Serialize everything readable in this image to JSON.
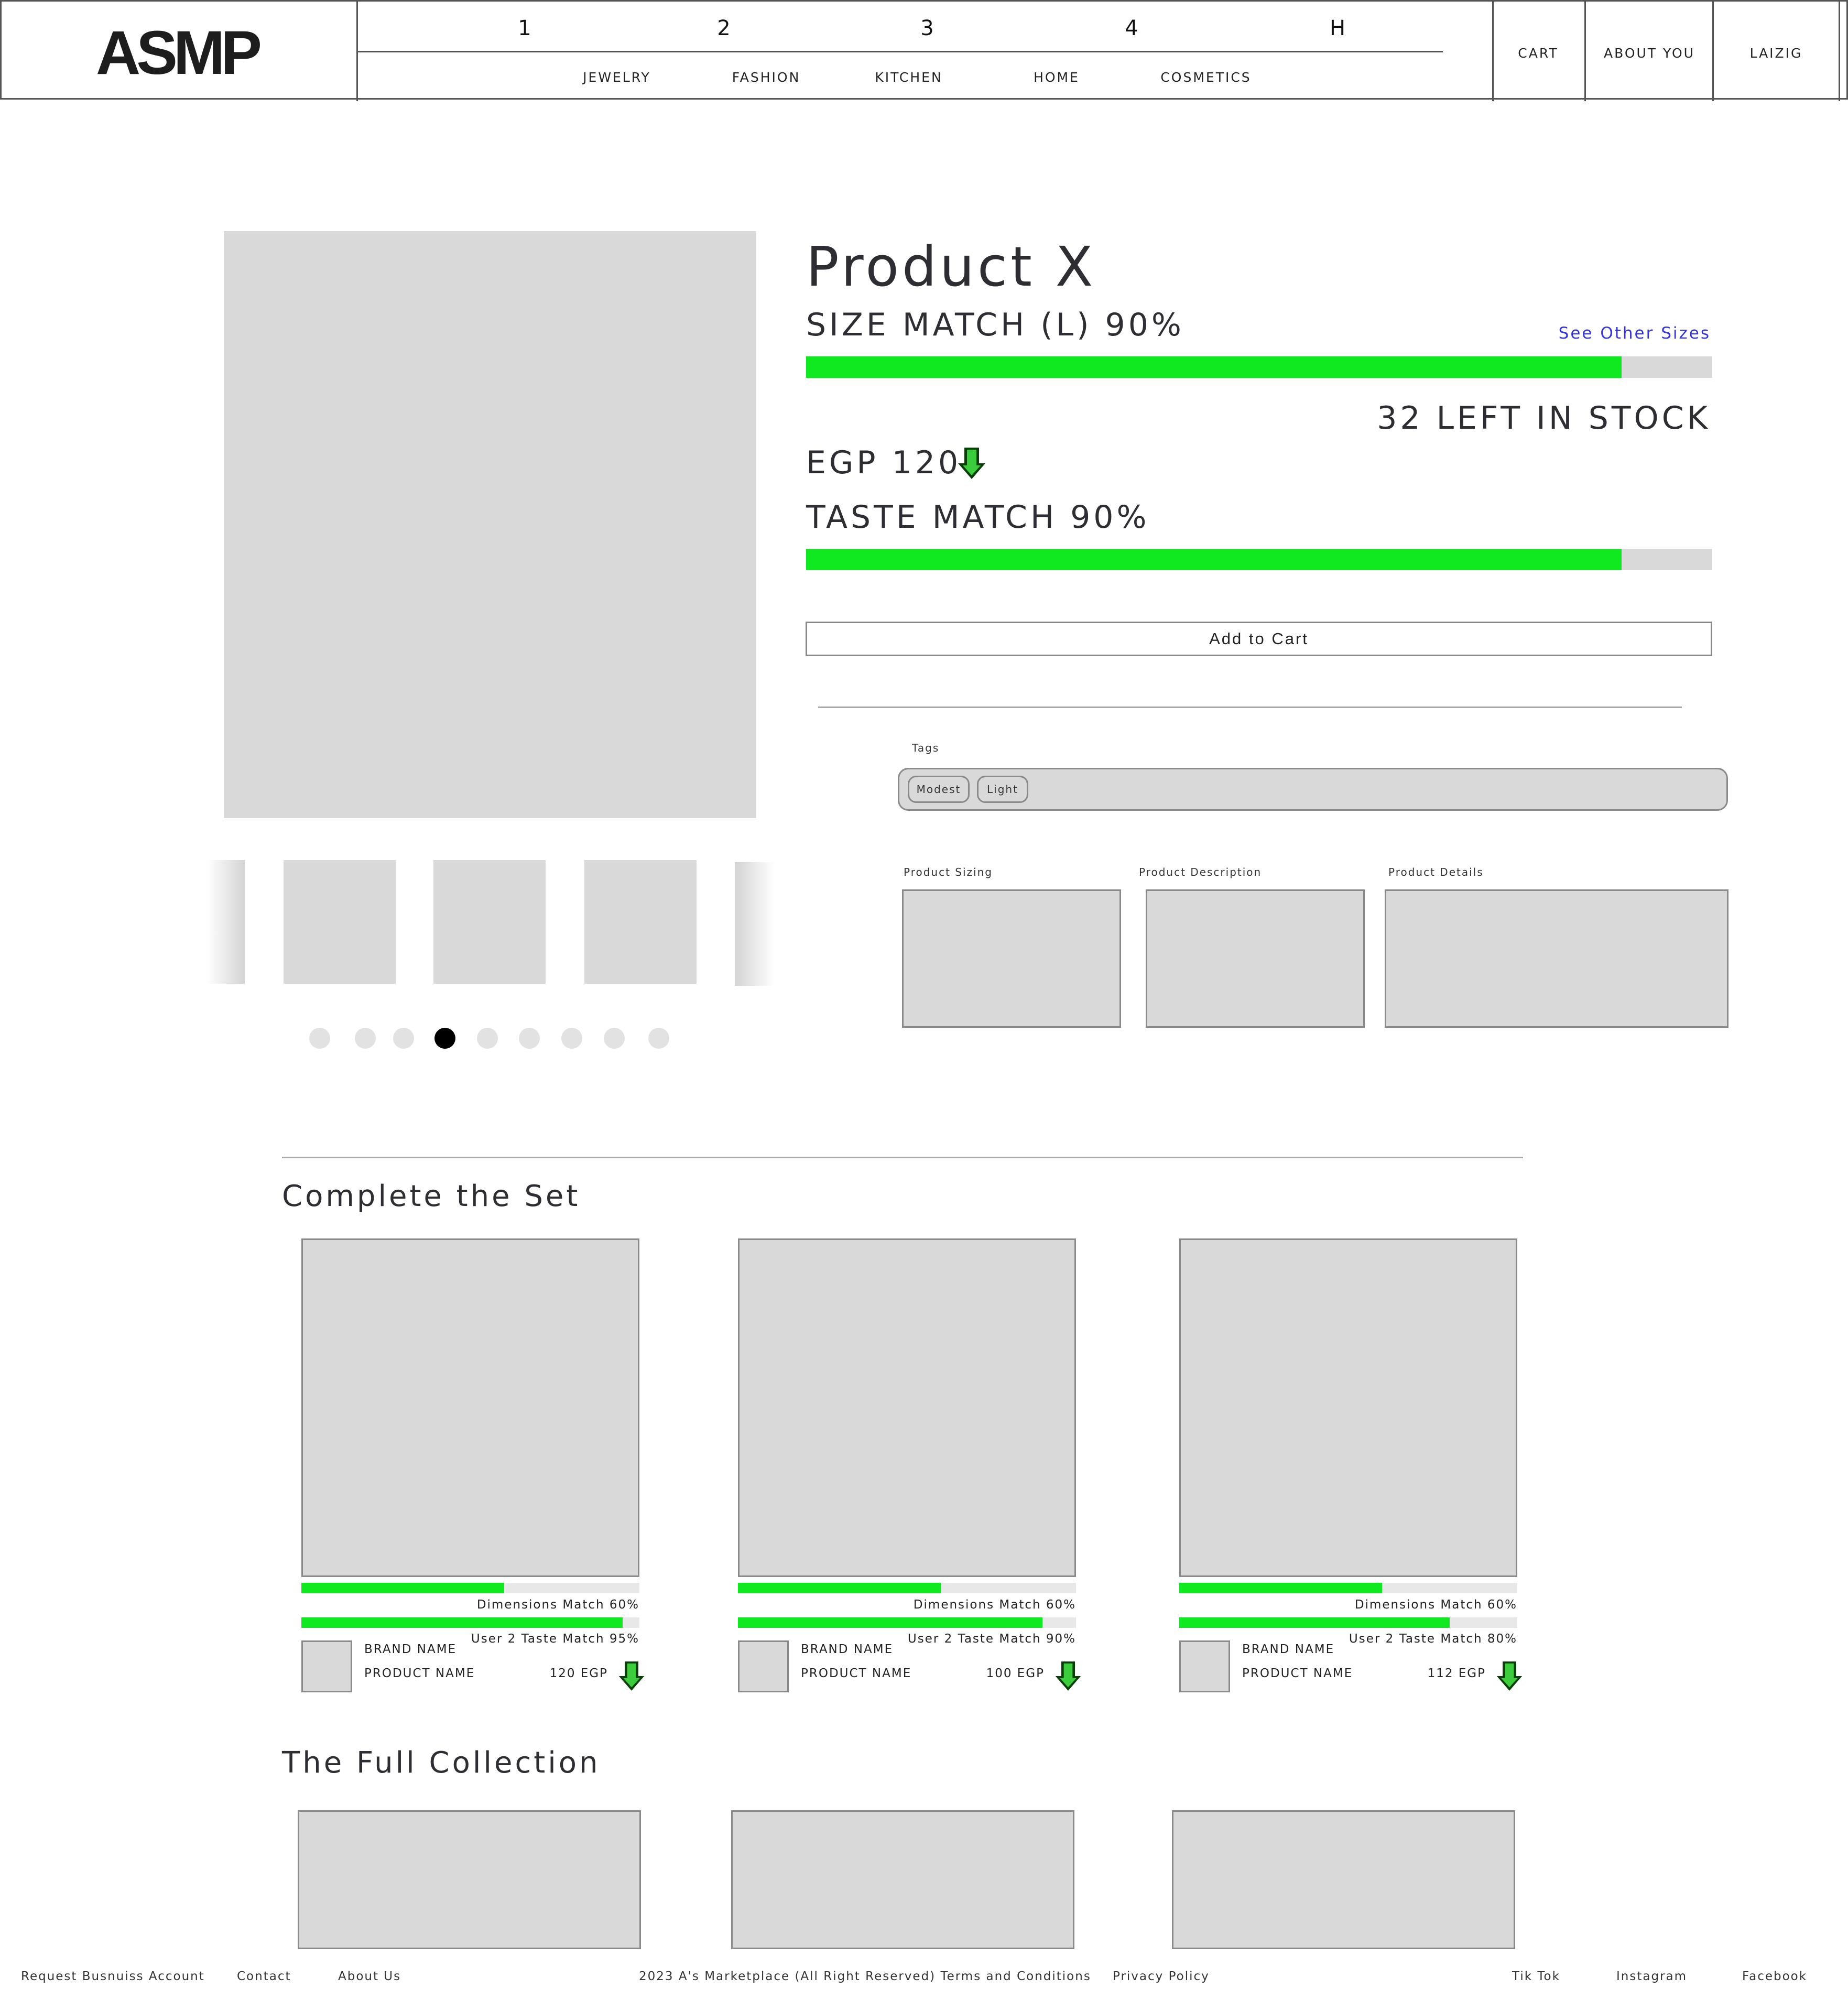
{
  "header": {
    "logo": "ASMP",
    "number_tabs": [
      "1",
      "2",
      "3",
      "4",
      "H"
    ],
    "categories": [
      "JEWELRY",
      "FASHION",
      "KITCHEN",
      "HOME",
      "COSMETICS"
    ],
    "links": {
      "cart": "CART",
      "about_you": "ABOUT YOU",
      "user": "LAIZIG"
    }
  },
  "gallery": {
    "dot_count": 9,
    "active_dot": 4
  },
  "product": {
    "title": "Product X",
    "size_match_label": "SIZE MATCH (L) 90%",
    "size_match_value": 0.9,
    "see_other_sizes": "See Other Sizes",
    "stock": "32 LEFT IN STOCK",
    "price": "EGP 120",
    "price_icon": "price-drop-arrow-icon",
    "taste_match_label": "TASTE MATCH 90%",
    "taste_match_value": 0.9,
    "add_to_cart": "Add to Cart",
    "tags_label": "Tags",
    "tags": [
      "Modest",
      "Light"
    ],
    "panels": {
      "sizing": "Product Sizing",
      "description": "Product Description",
      "details": "Product Details"
    }
  },
  "colors": {
    "match_bar": "#10e81f",
    "link": "#3232e0",
    "arrow_dark": "#0a3d0a",
    "arrow_light": "#3ccd3c"
  },
  "complete_set": {
    "title": "Complete the Set",
    "cards": [
      {
        "dimensions_label": "Dimensions Match 60%",
        "dimensions_value": 0.6,
        "taste_label": "User 2 Taste Match 95%",
        "taste_value": 0.95,
        "brand": "BRAND NAME",
        "product": "PRODUCT NAME",
        "price": "120 EGP"
      },
      {
        "dimensions_label": "Dimensions Match 60%",
        "dimensions_value": 0.6,
        "taste_label": "User 2 Taste Match 90%",
        "taste_value": 0.9,
        "brand": "BRAND NAME",
        "product": "PRODUCT NAME",
        "price": "100 EGP"
      },
      {
        "dimensions_label": "Dimensions Match 60%",
        "dimensions_value": 0.6,
        "taste_label": "User 2 Taste Match 80%",
        "taste_value": 0.8,
        "brand": "BRAND NAME",
        "product": "PRODUCT NAME",
        "price": "112 EGP"
      }
    ]
  },
  "full_collection": {
    "title": "The Full Collection"
  },
  "footer": {
    "request_account": "Request Busnuiss Account",
    "contact": "Contact",
    "about": "About Us",
    "copyright": "2023 A's Marketplace (All Right Reserved) Terms and Conditions",
    "privacy": "Privacy Policy",
    "tiktok": "Tik Tok",
    "instagram": "Instagram",
    "facebook": "Facebook"
  }
}
